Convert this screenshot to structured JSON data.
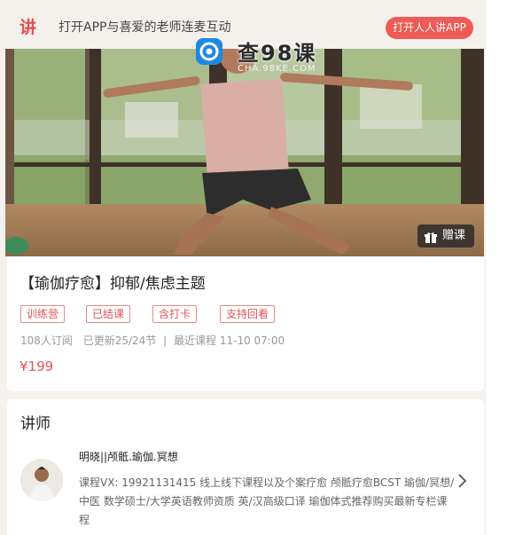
{
  "banner": {
    "logo": "讲",
    "text": "打开APP与喜爱的老师连麦互动",
    "open_button": "打开人人讲APP"
  },
  "watermark": {
    "title": "查98课",
    "url": "CHA.98KE.COM"
  },
  "hero": {
    "gift_label": "赠课"
  },
  "course": {
    "title": "【瑜伽疗愈】抑郁/焦虑主题",
    "tags": [
      "训练营",
      "已结课",
      "含打卡",
      "支持回看"
    ],
    "subscribers": "108人订阅",
    "updated": "已更新25/24节",
    "separator": "|",
    "latest": "最近课程 11-10 07:00",
    "price": "¥199"
  },
  "teacher": {
    "section_title": "讲师",
    "name": "明晓||颅骶.瑜伽.冥想",
    "bio": "课程VX: 19921131415 线上线下课程以及个案疗愈 颅骶疗愈BCST 瑜伽/冥想/中医 数学硕士/大学英语教师资质 英/汉高级口译 瑜伽体式推荐购买最新专栏课程"
  },
  "colors": {
    "accent": "#e05555",
    "button": "#ee5a55",
    "background": "#f5f2ee"
  }
}
